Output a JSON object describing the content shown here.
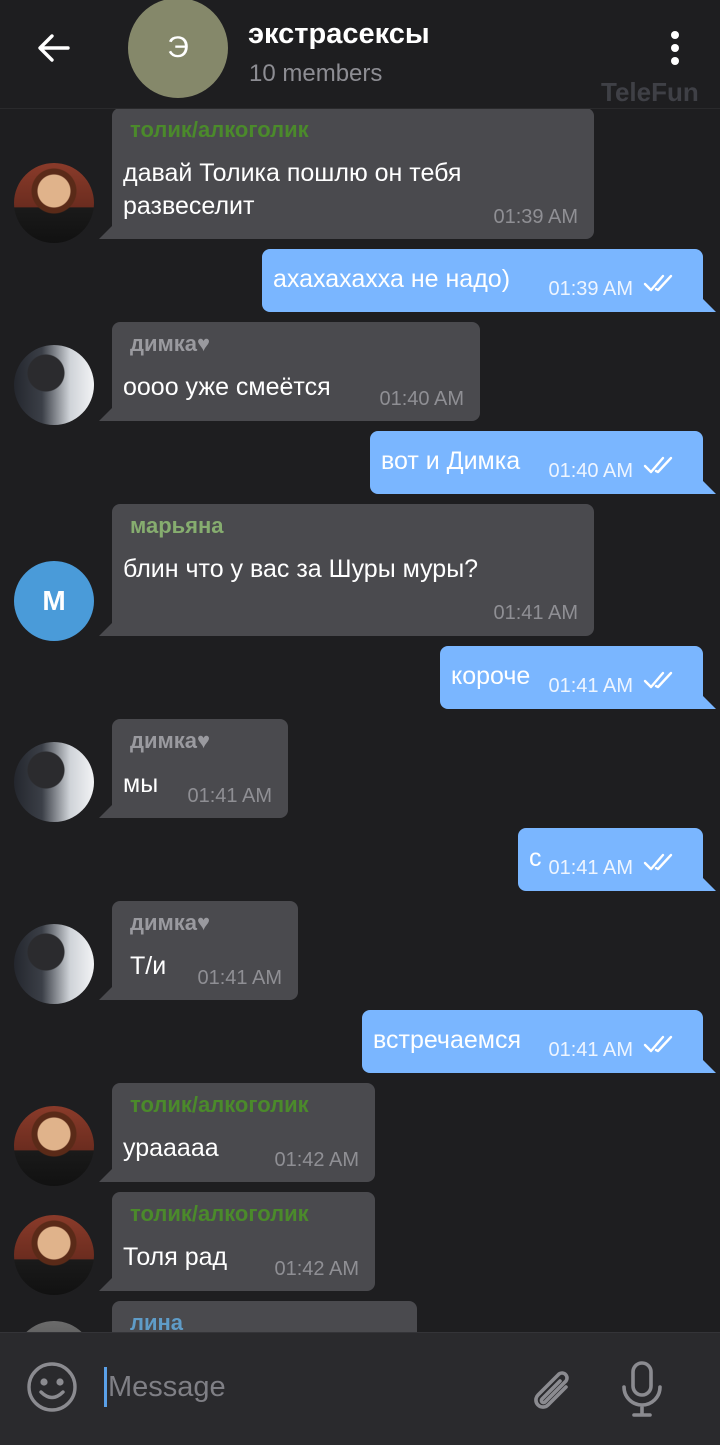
{
  "header": {
    "back_label": "Back",
    "avatar_letter": "Э",
    "title": "экстрасексы",
    "subtitle": "10 members"
  },
  "watermark": "TeleFun",
  "messages": [
    {
      "dir": "in",
      "sender": "толик/алкоголик",
      "text": "давай Толика пошлю он тебя\nразвеселит",
      "time": "01:39 AM"
    },
    {
      "dir": "out",
      "text": "ахахахахха не надо)",
      "time": "01:39 AM"
    },
    {
      "dir": "in",
      "sender": "димка♥",
      "text": "оооо уже смеётся",
      "time": "01:40 AM"
    },
    {
      "dir": "out",
      "text": "вот и Димка",
      "time": "01:40 AM"
    },
    {
      "dir": "in",
      "sender": "марьяна",
      "avatar_letter": "M",
      "text": "блин что у вас за Шуры муры?",
      "time": "01:41 AM"
    },
    {
      "dir": "out",
      "text": "короче",
      "time": "01:41 AM"
    },
    {
      "dir": "in",
      "sender": "димка♥",
      "text": "мы",
      "time": "01:41 AM"
    },
    {
      "dir": "out",
      "text": "с",
      "time": "01:41 AM"
    },
    {
      "dir": "in",
      "sender": "димка♥",
      "text": "Т/и",
      "time": "01:41 AM"
    },
    {
      "dir": "out",
      "text": "встречаемся",
      "time": "01:41 AM"
    },
    {
      "dir": "in",
      "sender": "толик/алкоголик",
      "text": "урааааа",
      "time": "01:42 AM"
    },
    {
      "dir": "in",
      "sender": "толик/алкоголик",
      "text": "Толя рад",
      "time": "01:42 AM"
    },
    {
      "dir": "in",
      "sender": "лина",
      "text": "",
      "time": ""
    }
  ],
  "composer": {
    "placeholder": "Message"
  }
}
